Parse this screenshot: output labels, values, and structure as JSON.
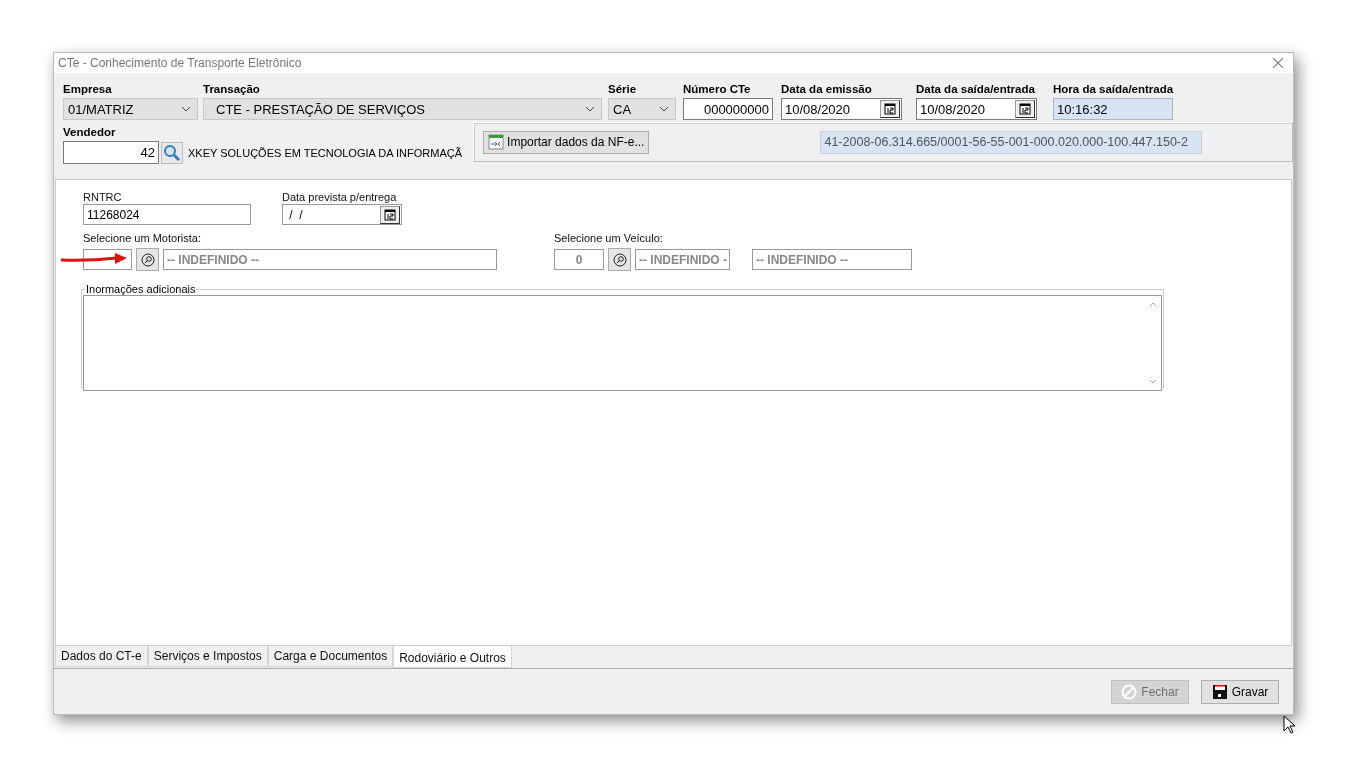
{
  "window": {
    "title": "CTe - Conhecimento de Transporte Eletrônico"
  },
  "header_fields": [
    {
      "label": "Empresa",
      "value": "01/MATRIZ",
      "kind": "combo"
    },
    {
      "label": "Transação",
      "value": "CTE - PRESTAÇÃO DE SERVIÇOS",
      "kind": "combo"
    },
    {
      "label": "Série",
      "value": "CA",
      "kind": "combo"
    },
    {
      "label": "Número CTe",
      "value": "000000000",
      "kind": "number"
    },
    {
      "label": "Data da emissão",
      "value": "10/08/2020",
      "kind": "date"
    },
    {
      "label": "Data da saída/entrada",
      "value": "10/08/2020",
      "kind": "date"
    },
    {
      "label": "Hora da saída/entrada",
      "value": "10:16:32",
      "kind": "readonly"
    }
  ],
  "vendedor": {
    "label": "Vendedor",
    "code": "42",
    "name": "XKEY SOLUÇÕES EM TECNOLOGIA DA INFORMAÇÃ"
  },
  "import_button": {
    "label": "Importar dados da NF-e..."
  },
  "nfe_key": {
    "value": "41-2008-06.314.665/0001-56-55-001-000.020.000-100.447.150-2"
  },
  "rntrc": {
    "label": "RNTRC",
    "value": "11268024"
  },
  "data_prevista": {
    "label": "Data prevista p/entrega",
    "value": " /  /"
  },
  "motorista": {
    "label": "Selecione um Motorista:",
    "name": "-- INDEFINIDO --"
  },
  "veiculo": {
    "label": "Selecione um Veículo:",
    "code": "0",
    "name": "-- INDEFINIDO -",
    "plate": "-- INDEFINIDO --"
  },
  "informacoes": {
    "label": "Inormações adicionais"
  },
  "tabs": [
    {
      "label": "Dados do CT-e",
      "selected": false
    },
    {
      "label": "Serviços e Impostos",
      "selected": false
    },
    {
      "label": "Carga e Documentos",
      "selected": false
    },
    {
      "label": "Rodoviário e Outros",
      "selected": true
    }
  ],
  "buttons": [
    {
      "label": "Fechar",
      "kind": "close",
      "disabled": true
    },
    {
      "label": "Gravar",
      "kind": "save",
      "disabled": false
    }
  ]
}
